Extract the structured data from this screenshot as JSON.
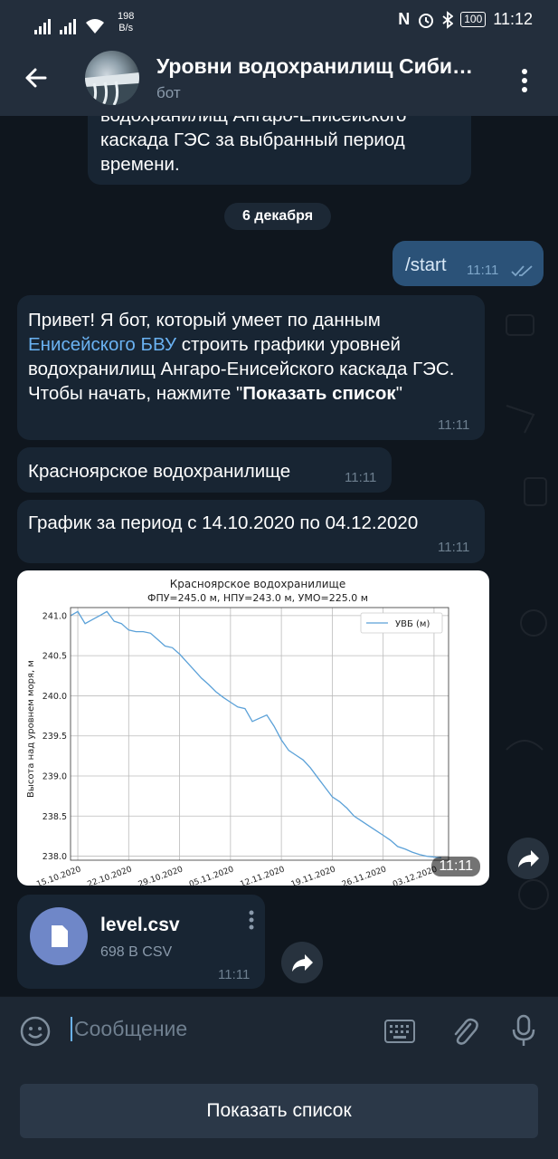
{
  "status_bar": {
    "net_speed_value": "198",
    "net_speed_unit": "B/s",
    "nfc_icon": "N",
    "battery": "100",
    "clock": "11:12"
  },
  "header": {
    "title": "Уровни водохранилищ Сиби…",
    "subtitle": "бот"
  },
  "messages": {
    "prev_fragment": {
      "line1": "водохранилищ Ангаро-Енисейского",
      "line2": "каскада ГЭС за выбранный период",
      "line3": "времени."
    },
    "date_separator": "6 декабря",
    "start": {
      "text": "/start",
      "time": "11:11"
    },
    "greeting": {
      "part1": "Привет! Я бот, который умеет по данным ",
      "link": "Енисейского БВУ",
      "part2": " строить графики уровней водохранилищ Ангаро-Енисейского каскада ГЭС. Чтобы начать, нажмите \"",
      "bold": "Показать список",
      "part3": "\"",
      "time": "11:11"
    },
    "reservoir": {
      "text": "Красноярское водохранилище",
      "time": "11:11"
    },
    "period": {
      "text": "График за период с 14.10.2020 по 04.12.2020",
      "time": "11:11"
    },
    "chart_time": "11:11",
    "file": {
      "name": "level.csv",
      "meta": "698 B CSV",
      "time": "11:11"
    }
  },
  "composer": {
    "placeholder": "Сообщение"
  },
  "keyboard": {
    "button": "Показать список"
  },
  "colors": {
    "background": "#0f161e",
    "bubble_in": "#182533",
    "bubble_out": "#2b5278",
    "link": "#6ab2f2",
    "series": "#5ba1d8"
  },
  "icons": {
    "back": "arrow-left-icon",
    "menu": "more-vert-icon",
    "share": "share-icon",
    "file": "file-icon",
    "emoji": "emoji-icon",
    "keyboard": "keyboard-icon",
    "attach": "attach-icon",
    "mic": "mic-icon"
  },
  "chart_data": {
    "type": "line",
    "title": "Красноярское водохранилище",
    "subtitle": "ФПУ=245.0 м, НПУ=243.0 м, УМО=225.0 м",
    "xlabel": "",
    "ylabel": "Высота над уровнем моря, м",
    "legend_position": "top-right",
    "grid": true,
    "xlim": [
      "2020-10-14",
      "2020-12-05"
    ],
    "ylim": [
      237.95,
      241.1
    ],
    "x_ticks": [
      "15.10.2020",
      "22.10.2020",
      "29.10.2020",
      "05.11.2020",
      "12.11.2020",
      "19.11.2020",
      "26.11.2020",
      "03.12.2020"
    ],
    "y_ticks": [
      "238.0",
      "238.5",
      "239.0",
      "239.5",
      "240.0",
      "240.5",
      "241.0"
    ],
    "series": [
      {
        "name": "УВБ (м)",
        "x": [
          "2020-10-14",
          "2020-10-15",
          "2020-10-16",
          "2020-10-17",
          "2020-10-18",
          "2020-10-19",
          "2020-10-20",
          "2020-10-21",
          "2020-10-22",
          "2020-10-23",
          "2020-10-24",
          "2020-10-25",
          "2020-10-26",
          "2020-10-27",
          "2020-10-28",
          "2020-10-29",
          "2020-10-30",
          "2020-10-31",
          "2020-11-01",
          "2020-11-02",
          "2020-11-03",
          "2020-11-04",
          "2020-11-05",
          "2020-11-06",
          "2020-11-07",
          "2020-11-08",
          "2020-11-09",
          "2020-11-10",
          "2020-11-11",
          "2020-11-12",
          "2020-11-13",
          "2020-11-14",
          "2020-11-15",
          "2020-11-16",
          "2020-11-17",
          "2020-11-18",
          "2020-11-19",
          "2020-11-20",
          "2020-11-21",
          "2020-11-22",
          "2020-11-23",
          "2020-11-24",
          "2020-11-25",
          "2020-11-26",
          "2020-11-27",
          "2020-11-28",
          "2020-11-29",
          "2020-11-30",
          "2020-12-01",
          "2020-12-02",
          "2020-12-03",
          "2020-12-04"
        ],
        "values": [
          241.0,
          241.05,
          240.9,
          240.95,
          241.0,
          241.05,
          240.93,
          240.9,
          240.82,
          240.8,
          240.8,
          240.78,
          240.7,
          240.62,
          240.6,
          240.52,
          240.42,
          240.32,
          240.22,
          240.14,
          240.05,
          239.98,
          239.92,
          239.86,
          239.84,
          239.68,
          239.72,
          239.76,
          239.62,
          239.45,
          239.32,
          239.26,
          239.2,
          239.1,
          238.98,
          238.86,
          238.74,
          238.68,
          238.6,
          238.5,
          238.44,
          238.38,
          238.32,
          238.26,
          238.2,
          238.12,
          238.09,
          238.05,
          238.02,
          238.0,
          237.99,
          237.98
        ]
      }
    ]
  }
}
